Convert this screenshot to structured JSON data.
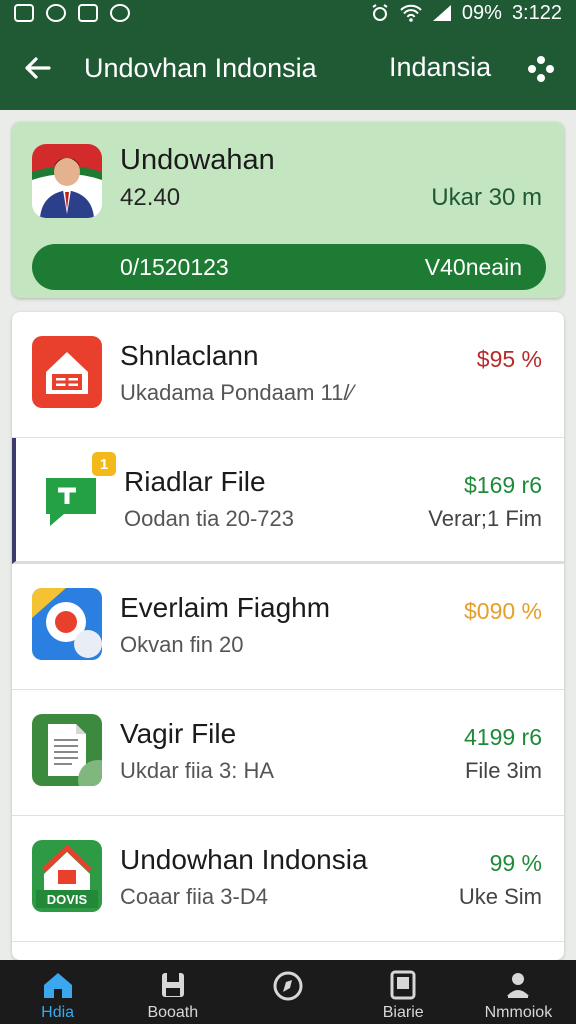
{
  "status_bar": {
    "battery": "09%",
    "time": "3:122"
  },
  "app_bar": {
    "title": "Undovhan Indonsia",
    "country": "Indansia"
  },
  "summary": {
    "name": "Undowahan",
    "amount": "42.40",
    "meta": "Ukar 30 m",
    "pill_left": "0/1520123",
    "pill_right": "V40neain"
  },
  "items": [
    {
      "title": "Shnlaclann",
      "subtitle": "Ukadama Pondaam 11/⁄",
      "value": "$95 %",
      "value_color": "#b72b2b",
      "note": "",
      "icon": "home-red-icon"
    },
    {
      "title": "Riadlar File",
      "subtitle": "Oodan tia 20-723",
      "value": "$169 r6",
      "value_color": "#1f8a3a",
      "note": "Verar;1 Fim",
      "icon": "chat-green-icon",
      "badge": "1"
    },
    {
      "title": "Everlaim Fiaghm",
      "subtitle": "Okvan fin 20",
      "value": "$090 %",
      "value_color": "#e3a02a",
      "note": "",
      "icon": "location-blue-icon"
    },
    {
      "title": "Vagir File",
      "subtitle": "Ukdar fiia 3: HA",
      "value": "4199 r6",
      "value_color": "#1f8a3a",
      "note": "File 3im",
      "icon": "document-green-icon"
    },
    {
      "title": "Undowhan Indonsia",
      "subtitle": "Coaar fiia 3-D4",
      "value": "99 %",
      "value_color": "#1f8a3a",
      "note": "Uke Sim",
      "icon": "house-green-icon",
      "icon_label": "DOVIS"
    }
  ],
  "nav": [
    {
      "label": "Hdia",
      "icon": "home-icon"
    },
    {
      "label": "Booath",
      "icon": "save-icon"
    },
    {
      "label": "",
      "icon": "circle-icon"
    },
    {
      "label": "Biarie",
      "icon": "tablet-icon"
    },
    {
      "label": "Nmmoiok",
      "icon": "person-icon"
    }
  ],
  "colors": {
    "primary": "#1f5a34",
    "accent_green": "#1e7b34",
    "summary_bg": "#c3e5c0",
    "nav_active": "#3aa7ef"
  }
}
